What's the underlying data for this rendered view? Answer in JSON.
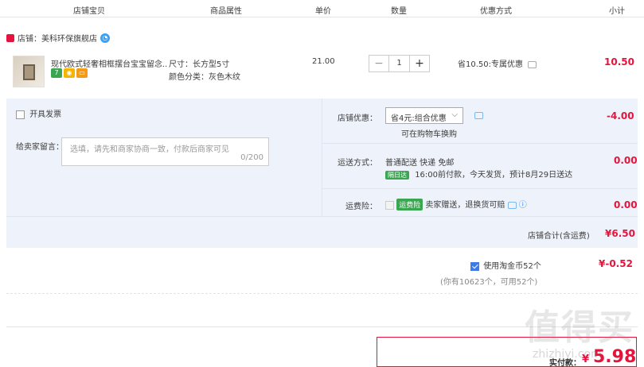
{
  "header": {
    "cols": [
      "店铺宝贝",
      "商品属性",
      "单价",
      "数量",
      "优惠方式",
      "小计"
    ]
  },
  "shop": {
    "label": "店铺：",
    "name": "美科环保旗舰店"
  },
  "item": {
    "title": "现代欧式轻奢相框摆台宝宝留念...",
    "attr_size": "尺寸：长方型5寸",
    "attr_color": "颜色分类：灰色木纹",
    "unit_price": "21.00",
    "quantity": "1",
    "minus": "−",
    "plus": "+",
    "discount": "省10.50:专属优惠",
    "subtotal": "10.50",
    "badge_7": "7"
  },
  "invoice": {
    "label": "开具发票"
  },
  "message": {
    "label": "给卖家留言：",
    "placeholder": "选填，请先和商家协商一致，付款后商家可见",
    "counter": "0/200"
  },
  "shop_discount": {
    "label": "店铺优惠：",
    "selected": "省4元:组合优惠",
    "note": "可在购物车换购",
    "amount": "-4.00"
  },
  "shipping": {
    "label": "运送方式：",
    "method": "普通配送 快递 免邮",
    "tag": "隔日达",
    "detail": "16:00前付款，今天发货，预计8月29日送达",
    "amount": "0.00"
  },
  "insurance": {
    "label": "运费险：",
    "tag": "运费险",
    "text": "卖家赠送，退换货可赔",
    "amount": "0.00"
  },
  "shop_total": {
    "label": "店铺合计(含运费)",
    "amount": "¥6.50"
  },
  "coins": {
    "label": "使用淘金币52个",
    "note": "(你有10623个，可用52个)",
    "amount": "¥-0.52"
  },
  "final": {
    "label": "实付款：",
    "currency": "¥",
    "amount": "5.98"
  },
  "watermark": {
    "big": "值得买",
    "small": "zhizhiyi.com"
  },
  "colors": {
    "accent": "#e5143c",
    "panel": "#eef3fb",
    "checkbox": "#3d7be8"
  }
}
